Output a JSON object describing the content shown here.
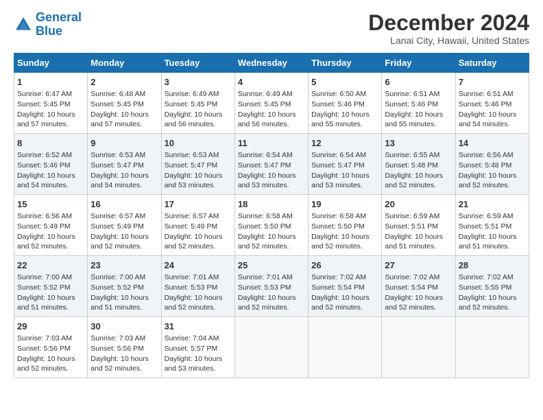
{
  "header": {
    "logo_line1": "General",
    "logo_line2": "Blue",
    "main_title": "December 2024",
    "subtitle": "Lanai City, Hawaii, United States"
  },
  "days_of_week": [
    "Sunday",
    "Monday",
    "Tuesday",
    "Wednesday",
    "Thursday",
    "Friday",
    "Saturday"
  ],
  "weeks": [
    [
      {
        "day": 1,
        "sunrise": "6:47 AM",
        "sunset": "5:45 PM",
        "daylight": "10 hours and 57 minutes."
      },
      {
        "day": 2,
        "sunrise": "6:48 AM",
        "sunset": "5:45 PM",
        "daylight": "10 hours and 57 minutes."
      },
      {
        "day": 3,
        "sunrise": "6:49 AM",
        "sunset": "5:45 PM",
        "daylight": "10 hours and 56 minutes."
      },
      {
        "day": 4,
        "sunrise": "6:49 AM",
        "sunset": "5:45 PM",
        "daylight": "10 hours and 56 minutes."
      },
      {
        "day": 5,
        "sunrise": "6:50 AM",
        "sunset": "5:46 PM",
        "daylight": "10 hours and 55 minutes."
      },
      {
        "day": 6,
        "sunrise": "6:51 AM",
        "sunset": "5:46 PM",
        "daylight": "10 hours and 55 minutes."
      },
      {
        "day": 7,
        "sunrise": "6:51 AM",
        "sunset": "5:46 PM",
        "daylight": "10 hours and 54 minutes."
      }
    ],
    [
      {
        "day": 8,
        "sunrise": "6:52 AM",
        "sunset": "5:46 PM",
        "daylight": "10 hours and 54 minutes."
      },
      {
        "day": 9,
        "sunrise": "6:53 AM",
        "sunset": "5:47 PM",
        "daylight": "10 hours and 54 minutes."
      },
      {
        "day": 10,
        "sunrise": "6:53 AM",
        "sunset": "5:47 PM",
        "daylight": "10 hours and 53 minutes."
      },
      {
        "day": 11,
        "sunrise": "6:54 AM",
        "sunset": "5:47 PM",
        "daylight": "10 hours and 53 minutes."
      },
      {
        "day": 12,
        "sunrise": "6:54 AM",
        "sunset": "5:47 PM",
        "daylight": "10 hours and 53 minutes."
      },
      {
        "day": 13,
        "sunrise": "6:55 AM",
        "sunset": "5:48 PM",
        "daylight": "10 hours and 52 minutes."
      },
      {
        "day": 14,
        "sunrise": "6:56 AM",
        "sunset": "5:48 PM",
        "daylight": "10 hours and 52 minutes."
      }
    ],
    [
      {
        "day": 15,
        "sunrise": "6:56 AM",
        "sunset": "5:49 PM",
        "daylight": "10 hours and 52 minutes."
      },
      {
        "day": 16,
        "sunrise": "6:57 AM",
        "sunset": "5:49 PM",
        "daylight": "10 hours and 52 minutes."
      },
      {
        "day": 17,
        "sunrise": "6:57 AM",
        "sunset": "5:49 PM",
        "daylight": "10 hours and 52 minutes."
      },
      {
        "day": 18,
        "sunrise": "6:58 AM",
        "sunset": "5:50 PM",
        "daylight": "10 hours and 52 minutes."
      },
      {
        "day": 19,
        "sunrise": "6:58 AM",
        "sunset": "5:50 PM",
        "daylight": "10 hours and 52 minutes."
      },
      {
        "day": 20,
        "sunrise": "6:59 AM",
        "sunset": "5:51 PM",
        "daylight": "10 hours and 51 minutes."
      },
      {
        "day": 21,
        "sunrise": "6:59 AM",
        "sunset": "5:51 PM",
        "daylight": "10 hours and 51 minutes."
      }
    ],
    [
      {
        "day": 22,
        "sunrise": "7:00 AM",
        "sunset": "5:52 PM",
        "daylight": "10 hours and 51 minutes."
      },
      {
        "day": 23,
        "sunrise": "7:00 AM",
        "sunset": "5:52 PM",
        "daylight": "10 hours and 51 minutes."
      },
      {
        "day": 24,
        "sunrise": "7:01 AM",
        "sunset": "5:53 PM",
        "daylight": "10 hours and 52 minutes."
      },
      {
        "day": 25,
        "sunrise": "7:01 AM",
        "sunset": "5:53 PM",
        "daylight": "10 hours and 52 minutes."
      },
      {
        "day": 26,
        "sunrise": "7:02 AM",
        "sunset": "5:54 PM",
        "daylight": "10 hours and 52 minutes."
      },
      {
        "day": 27,
        "sunrise": "7:02 AM",
        "sunset": "5:54 PM",
        "daylight": "10 hours and 52 minutes."
      },
      {
        "day": 28,
        "sunrise": "7:02 AM",
        "sunset": "5:55 PM",
        "daylight": "10 hours and 52 minutes."
      }
    ],
    [
      {
        "day": 29,
        "sunrise": "7:03 AM",
        "sunset": "5:56 PM",
        "daylight": "10 hours and 52 minutes."
      },
      {
        "day": 30,
        "sunrise": "7:03 AM",
        "sunset": "5:56 PM",
        "daylight": "10 hours and 52 minutes."
      },
      {
        "day": 31,
        "sunrise": "7:04 AM",
        "sunset": "5:57 PM",
        "daylight": "10 hours and 53 minutes."
      },
      null,
      null,
      null,
      null
    ]
  ]
}
